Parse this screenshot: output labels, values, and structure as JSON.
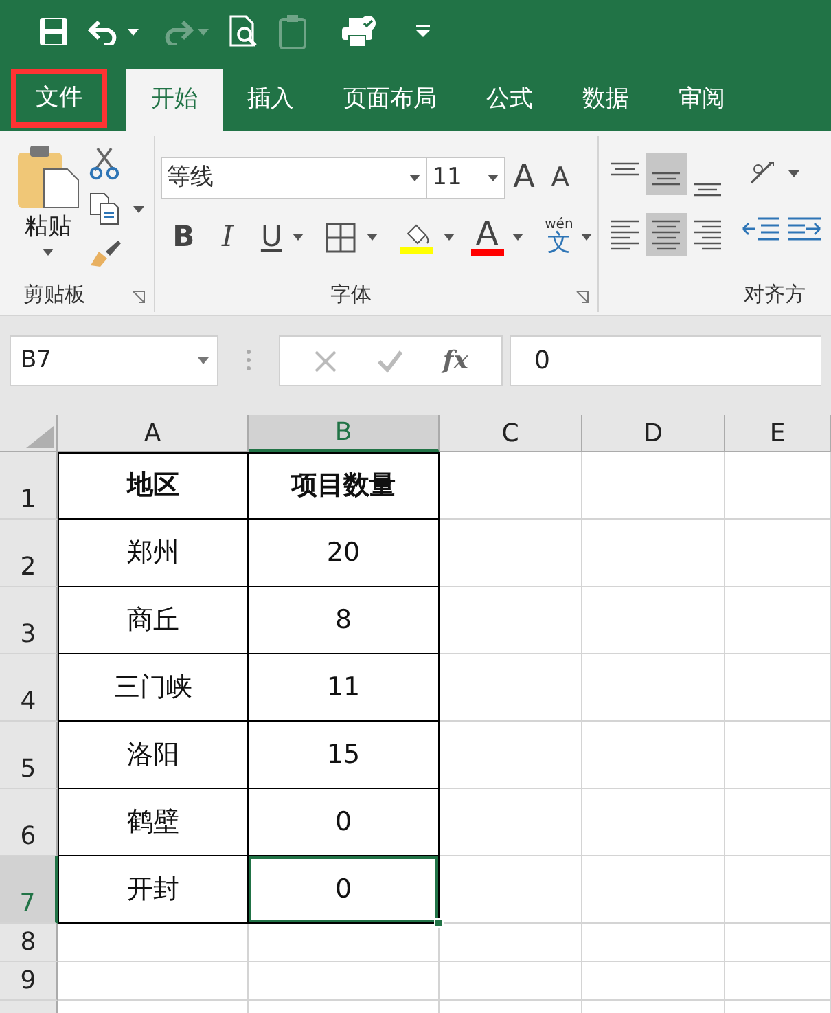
{
  "quick_access": [
    {
      "kind": "save",
      "disabled": false,
      "dropdown": false
    },
    {
      "kind": "undo",
      "disabled": false,
      "dropdown": true
    },
    {
      "kind": "redo",
      "disabled": true,
      "dropdown": true
    },
    {
      "kind": "preview",
      "disabled": false,
      "dropdown": false
    },
    {
      "kind": "clipboard",
      "disabled": true,
      "dropdown": false
    },
    {
      "kind": "printer",
      "disabled": false,
      "dropdown": false
    },
    {
      "kind": "customize",
      "disabled": false,
      "dropdown": false
    }
  ],
  "tabs": [
    {
      "label": "文件",
      "selected": false,
      "highlighted": true
    },
    {
      "label": "开始",
      "selected": true,
      "highlighted": false
    },
    {
      "label": "插入",
      "selected": false,
      "highlighted": false
    },
    {
      "label": "页面布局",
      "selected": false,
      "highlighted": false
    },
    {
      "label": "公式",
      "selected": false,
      "highlighted": false
    },
    {
      "label": "数据",
      "selected": false,
      "highlighted": false
    },
    {
      "label": "审阅",
      "selected": false,
      "highlighted": false
    }
  ],
  "ribbon": {
    "clipboard": {
      "label": "剪贴板",
      "paste": "粘贴"
    },
    "font": {
      "label": "字体",
      "name": "等线",
      "size": "11",
      "grow": "A",
      "shrink": "A",
      "bold": "B",
      "italic": "I",
      "underline": "U",
      "color_letter": "A",
      "pinyin_top": "wén",
      "pinyin_char": "文"
    },
    "alignment": {
      "label": "对齐方",
      "vertical": [
        {
          "kind": "top",
          "selected": false
        },
        {
          "kind": "middle",
          "selected": true
        },
        {
          "kind": "bottom",
          "selected": false
        }
      ],
      "horizontal": [
        {
          "kind": "left",
          "selected": false
        },
        {
          "kind": "center",
          "selected": true
        },
        {
          "kind": "right",
          "selected": false
        }
      ]
    }
  },
  "formula_bar": {
    "name_box": "B7",
    "function": "fx",
    "value": "0"
  },
  "sheet": {
    "columns": [
      {
        "label": "A",
        "selected": false
      },
      {
        "label": "B",
        "selected": true
      },
      {
        "label": "C",
        "selected": false
      },
      {
        "label": "D",
        "selected": false
      },
      {
        "label": "E",
        "selected": false
      }
    ],
    "rows": [
      {
        "header": "1",
        "selected": false,
        "bold": true,
        "cells": [
          {
            "text": "地区",
            "selected": false
          },
          {
            "text": "项目数量",
            "selected": false
          }
        ]
      },
      {
        "header": "2",
        "selected": false,
        "bold": false,
        "cells": [
          {
            "text": "郑州",
            "selected": false
          },
          {
            "text": "20",
            "selected": false
          }
        ]
      },
      {
        "header": "3",
        "selected": false,
        "bold": false,
        "cells": [
          {
            "text": "商丘",
            "selected": false
          },
          {
            "text": "8",
            "selected": false
          }
        ]
      },
      {
        "header": "4",
        "selected": false,
        "bold": false,
        "cells": [
          {
            "text": "三门峡",
            "selected": false
          },
          {
            "text": "11",
            "selected": false
          }
        ]
      },
      {
        "header": "5",
        "selected": false,
        "bold": false,
        "cells": [
          {
            "text": "洛阳",
            "selected": false
          },
          {
            "text": "15",
            "selected": false
          }
        ]
      },
      {
        "header": "6",
        "selected": false,
        "bold": false,
        "cells": [
          {
            "text": "鹤壁",
            "selected": false
          },
          {
            "text": "0",
            "selected": false
          }
        ]
      },
      {
        "header": "7",
        "selected": true,
        "bold": false,
        "cells": [
          {
            "text": "开封",
            "selected": false
          },
          {
            "text": "0",
            "selected": true
          }
        ]
      },
      {
        "header": "8",
        "selected": false
      },
      {
        "header": "9",
        "selected": false
      }
    ]
  }
}
